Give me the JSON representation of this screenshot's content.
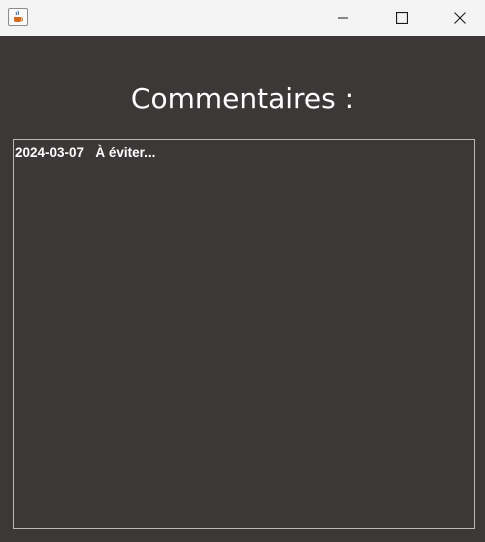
{
  "titlebar": {
    "icon": "java-cup-icon",
    "controls": [
      "minimize-icon",
      "maximize-icon",
      "close-icon"
    ]
  },
  "main": {
    "heading": "Commentaires :",
    "comments": [
      {
        "date": "2024-03-07",
        "text": "À éviter..."
      }
    ]
  },
  "colors": {
    "background": "#3c3837",
    "titlebar": "#f3f3f3",
    "text": "#ffffff",
    "border": "#b9b9b9"
  }
}
